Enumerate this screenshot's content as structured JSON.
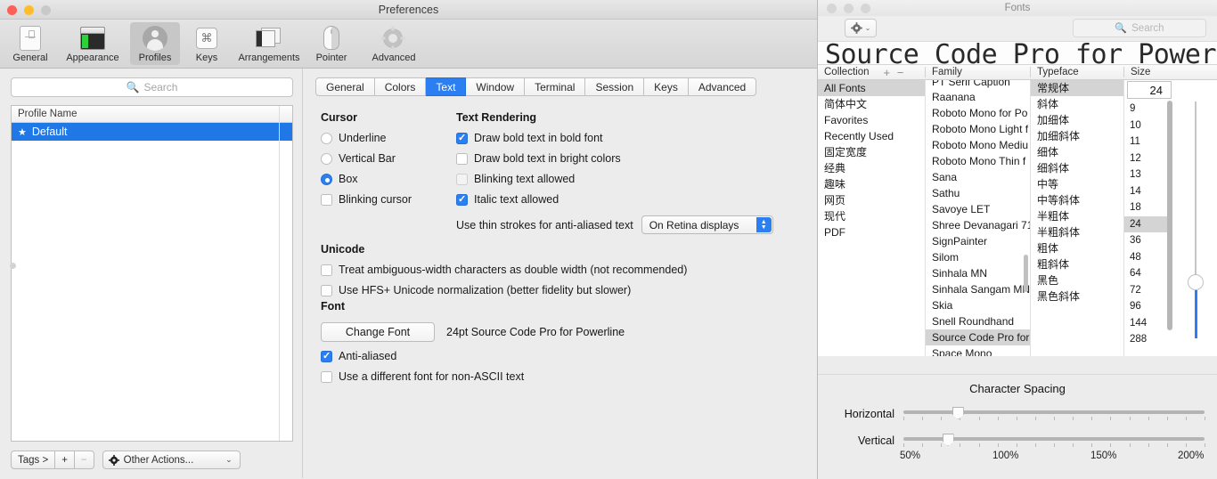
{
  "preferences": {
    "title": "Preferences",
    "toolbar": [
      {
        "label": "General",
        "icon": "general-icon",
        "selected": false
      },
      {
        "label": "Appearance",
        "icon": "appearance-icon",
        "selected": false
      },
      {
        "label": "Profiles",
        "icon": "profiles-icon",
        "selected": true
      },
      {
        "label": "Keys",
        "icon": "keys-icon",
        "selected": false
      },
      {
        "label": "Arrangements",
        "icon": "arrangements-icon",
        "selected": false
      },
      {
        "label": "Pointer",
        "icon": "pointer-icon",
        "selected": false
      },
      {
        "label": "Advanced",
        "icon": "advanced-icon",
        "selected": false
      }
    ],
    "sidebar": {
      "search_placeholder": "Search",
      "column_header": "Profile Name",
      "rows": [
        {
          "star": "★",
          "name": "Default",
          "selected": true
        }
      ],
      "toolbar": {
        "tags_label": "Tags >",
        "add_label": "+",
        "remove_label": "−",
        "other_actions_label": "Other Actions...",
        "other_actions_chevron": "⌄"
      }
    },
    "tabs": [
      {
        "label": "General",
        "active": false
      },
      {
        "label": "Colors",
        "active": false
      },
      {
        "label": "Text",
        "active": true
      },
      {
        "label": "Window",
        "active": false
      },
      {
        "label": "Terminal",
        "active": false
      },
      {
        "label": "Session",
        "active": false
      },
      {
        "label": "Keys",
        "active": false
      },
      {
        "label": "Advanced",
        "active": false
      }
    ],
    "cursor": {
      "title": "Cursor",
      "options": [
        {
          "label": "Underline",
          "type": "radio",
          "checked": false
        },
        {
          "label": "Vertical Bar",
          "type": "radio",
          "checked": false
        },
        {
          "label": "Box",
          "type": "radio",
          "checked": true
        },
        {
          "label": "Blinking cursor",
          "type": "checkbox",
          "checked": false
        }
      ]
    },
    "text_rendering": {
      "title": "Text Rendering",
      "options": [
        {
          "label": "Draw bold text in bold font",
          "checked": true,
          "dim": false
        },
        {
          "label": "Draw bold text in bright colors",
          "checked": false,
          "dim": false
        },
        {
          "label": "Blinking text allowed",
          "checked": false,
          "dim": true
        },
        {
          "label": "Italic text allowed",
          "checked": true,
          "dim": false
        }
      ],
      "thin_strokes_label": "Use thin strokes for anti-aliased text",
      "thin_strokes_value": "On Retina displays"
    },
    "unicode": {
      "title": "Unicode",
      "options": [
        {
          "label": "Treat ambiguous-width characters as double width (not recommended)",
          "checked": false
        },
        {
          "label": "Use HFS+ Unicode normalization (better fidelity but slower)",
          "checked": false
        }
      ]
    },
    "font": {
      "title": "Font",
      "change_font_label": "Change Font",
      "current_font": "24pt Source Code Pro for Powerline",
      "options": [
        {
          "label": "Anti-aliased",
          "checked": true
        },
        {
          "label": "Use a different font for non-ASCII text",
          "checked": false
        }
      ]
    }
  },
  "fonts_window": {
    "title": "Fonts",
    "gear_chevron": "⌄",
    "search_placeholder": "Search",
    "preview_text": "Source Code Pro for Powerline",
    "columns": {
      "collection_header": "Collection",
      "add_remove": "+ −",
      "family_header": "Family",
      "typeface_header": "Typeface",
      "size_header": "Size"
    },
    "collections": [
      {
        "label": "All Fonts",
        "selected": true
      },
      {
        "label": "简体中文",
        "selected": false
      },
      {
        "label": "Favorites",
        "selected": false
      },
      {
        "label": "Recently Used",
        "selected": false
      },
      {
        "label": "固定宽度",
        "selected": false
      },
      {
        "label": "经典",
        "selected": false
      },
      {
        "label": "趣味",
        "selected": false
      },
      {
        "label": "网页",
        "selected": false
      },
      {
        "label": "现代",
        "selected": false
      },
      {
        "label": "PDF",
        "selected": false
      }
    ],
    "families": [
      {
        "label": "PT Serif Caption",
        "selected": false
      },
      {
        "label": "Raanana",
        "selected": false
      },
      {
        "label": "Roboto Mono for Po",
        "selected": false
      },
      {
        "label": "Roboto Mono Light f",
        "selected": false
      },
      {
        "label": "Roboto Mono Mediu",
        "selected": false
      },
      {
        "label": "Roboto Mono Thin f",
        "selected": false
      },
      {
        "label": "Sana",
        "selected": false
      },
      {
        "label": "Sathu",
        "selected": false
      },
      {
        "label": "Savoye LET",
        "selected": false
      },
      {
        "label": "Shree Devanagari 71",
        "selected": false
      },
      {
        "label": "SignPainter",
        "selected": false
      },
      {
        "label": "Silom",
        "selected": false
      },
      {
        "label": "Sinhala MN",
        "selected": false
      },
      {
        "label": "Sinhala Sangam MN",
        "selected": false
      },
      {
        "label": "Skia",
        "selected": false
      },
      {
        "label": "Snell Roundhand",
        "selected": false
      },
      {
        "label": "Source Code Pro for",
        "selected": true
      },
      {
        "label": "Space Mono",
        "selected": false
      }
    ],
    "typefaces": [
      {
        "label": "常规体",
        "selected": true
      },
      {
        "label": "斜体",
        "selected": false
      },
      {
        "label": "加细体",
        "selected": false
      },
      {
        "label": "加细斜体",
        "selected": false
      },
      {
        "label": "细体",
        "selected": false
      },
      {
        "label": "细斜体",
        "selected": false
      },
      {
        "label": "中等",
        "selected": false
      },
      {
        "label": "中等斜体",
        "selected": false
      },
      {
        "label": "半粗体",
        "selected": false
      },
      {
        "label": "半粗斜体",
        "selected": false
      },
      {
        "label": "粗体",
        "selected": false
      },
      {
        "label": "粗斜体",
        "selected": false
      },
      {
        "label": "黑色",
        "selected": false
      },
      {
        "label": "黑色斜体",
        "selected": false
      }
    ],
    "size_value": "24",
    "sizes": [
      {
        "label": "9",
        "selected": false
      },
      {
        "label": "10",
        "selected": false
      },
      {
        "label": "11",
        "selected": false
      },
      {
        "label": "12",
        "selected": false
      },
      {
        "label": "13",
        "selected": false
      },
      {
        "label": "14",
        "selected": false
      },
      {
        "label": "18",
        "selected": false
      },
      {
        "label": "24",
        "selected": true
      },
      {
        "label": "36",
        "selected": false
      },
      {
        "label": "48",
        "selected": false
      },
      {
        "label": "64",
        "selected": false
      },
      {
        "label": "72",
        "selected": false
      },
      {
        "label": "96",
        "selected": false
      },
      {
        "label": "144",
        "selected": false
      },
      {
        "label": "288",
        "selected": false
      }
    ],
    "character_spacing": {
      "title": "Character Spacing",
      "horizontal_label": "Horizontal",
      "vertical_label": "Vertical",
      "horizontal_percent": 77,
      "vertical_percent": 72,
      "scale": [
        "50%",
        "100%",
        "150%",
        "200%"
      ]
    }
  },
  "colors": {
    "accent_blue": "#2b7ff0",
    "selection_blue": "#1f78e6",
    "window_bg": "#ececec",
    "traffic_red": "#ff5f57",
    "traffic_yellow": "#ffbd2e",
    "traffic_grey": "#c9c9c9"
  }
}
